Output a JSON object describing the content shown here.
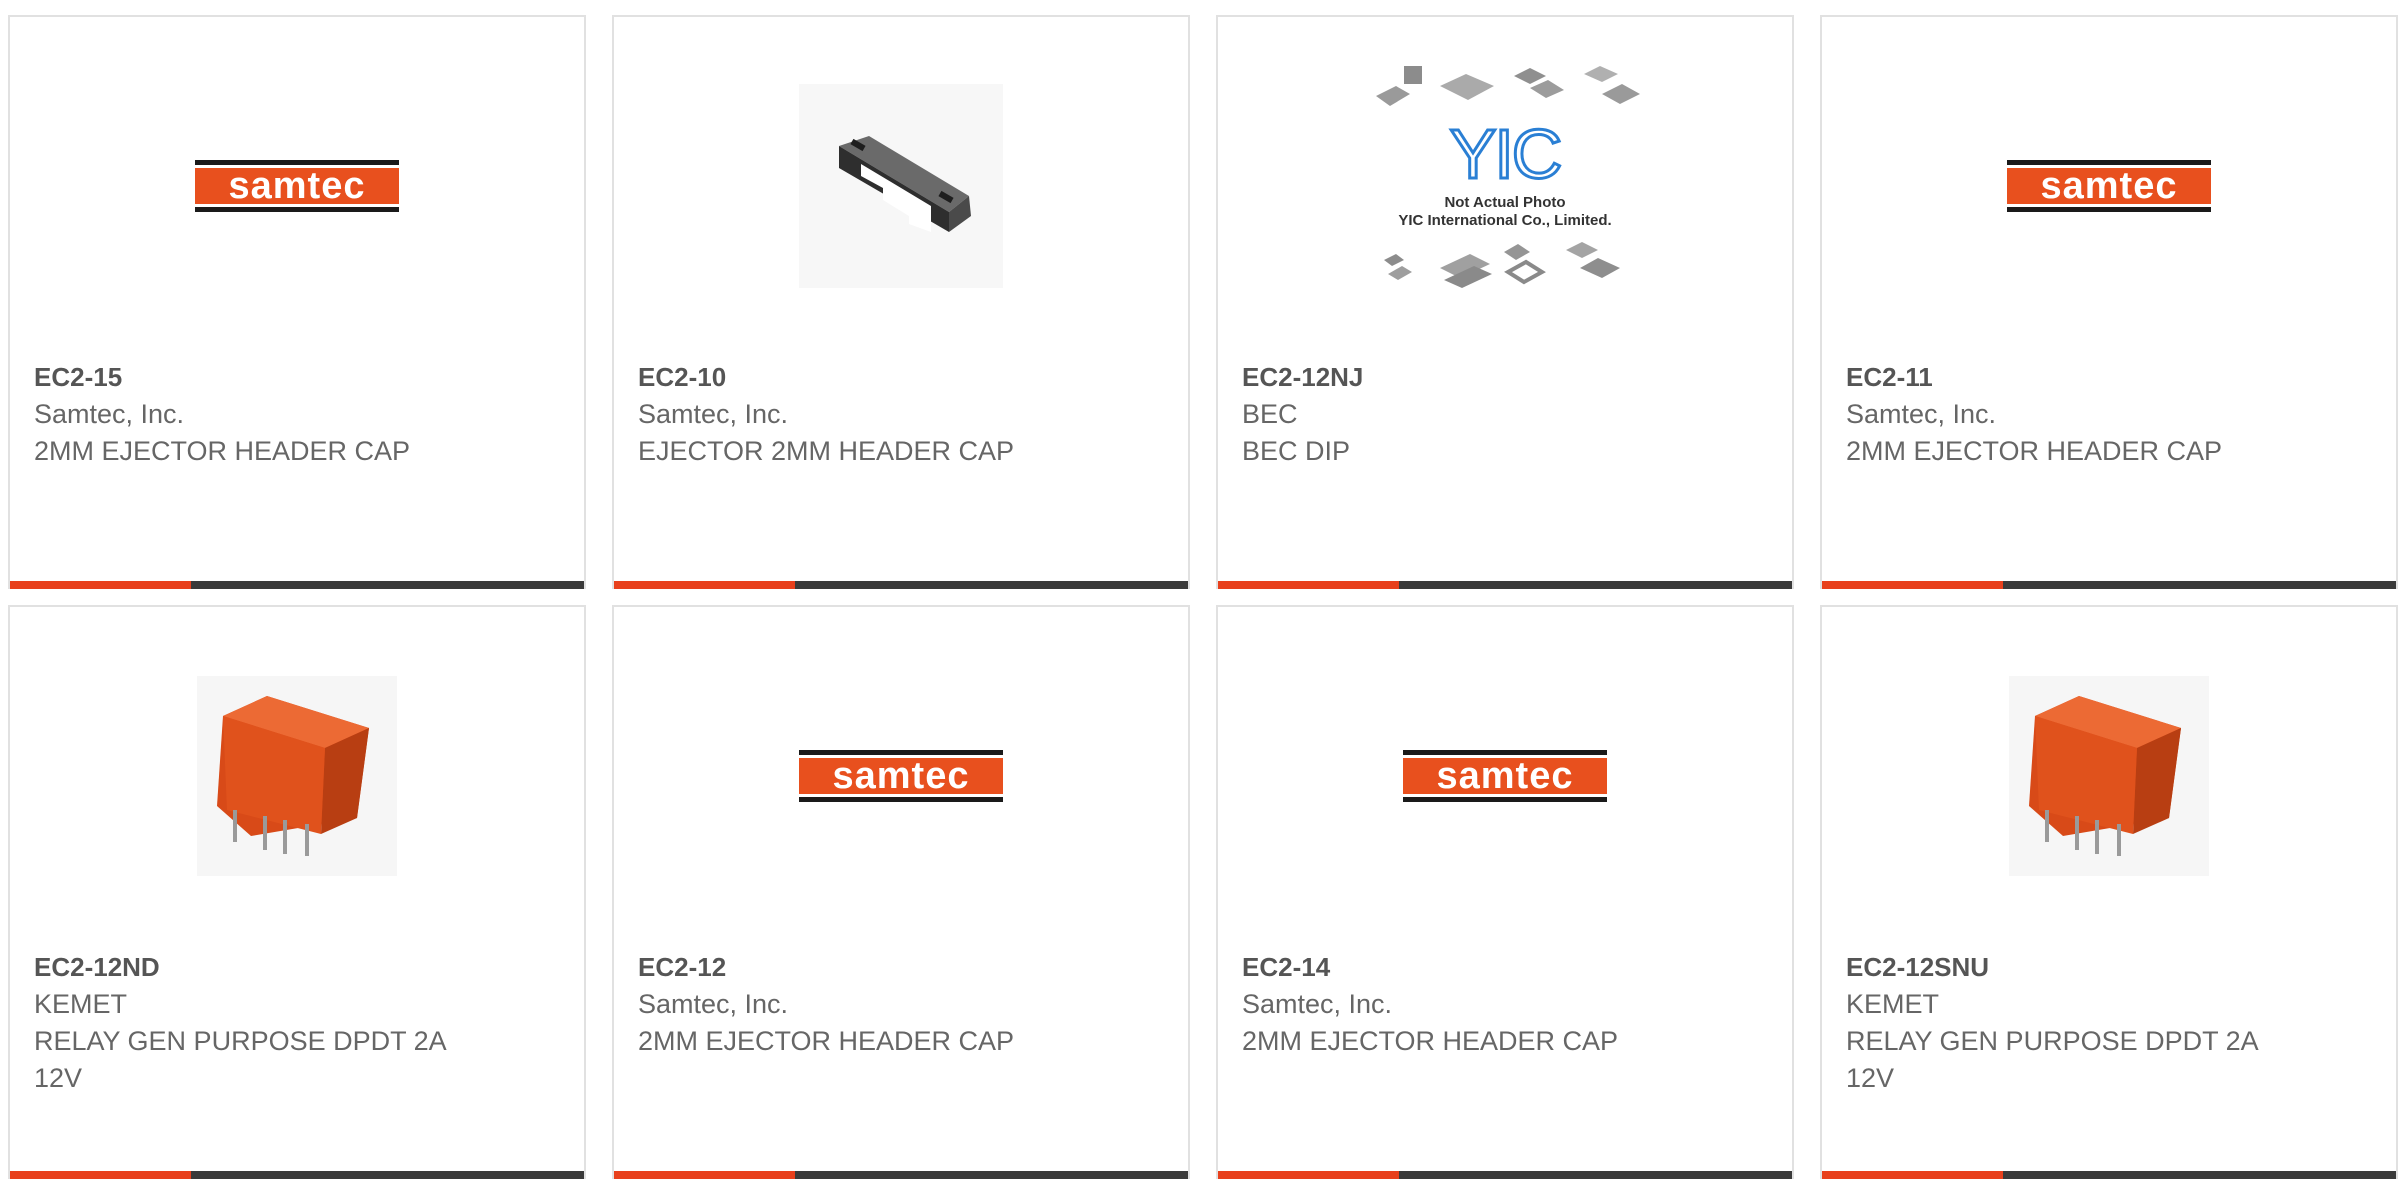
{
  "colors": {
    "accent_orange": "#e8401c",
    "accent_dark": "#3a3a3a",
    "card_border": "#e1e1e1",
    "text_gray": "#666666",
    "samtec_orange": "#e8501e",
    "relay_orange": "#e0521c",
    "yic_blue": "#2a7fd4"
  },
  "products": [
    {
      "part_number": "EC2-15",
      "manufacturer": "Samtec, Inc.",
      "description": "2MM EJECTOR HEADER CAP",
      "image": "samtec-logo",
      "logo_text": "samtec"
    },
    {
      "part_number": "EC2-10",
      "manufacturer": "Samtec, Inc.",
      "description": "EJECTOR 2MM HEADER CAP",
      "image": "ejector-cap-photo"
    },
    {
      "part_number": "EC2-12NJ",
      "manufacturer": "BEC",
      "description": "BEC DIP",
      "image": "yic-placeholder",
      "logo_text": "YIC",
      "caption_line1": "Not Actual Photo",
      "caption_line2": "YIC International Co., Limited."
    },
    {
      "part_number": "EC2-11",
      "manufacturer": "Samtec, Inc.",
      "description": "2MM EJECTOR HEADER CAP",
      "image": "samtec-logo",
      "logo_text": "samtec"
    },
    {
      "part_number": "EC2-12ND",
      "manufacturer": "KEMET",
      "description": "RELAY GEN PURPOSE DPDT 2A 12V",
      "image": "relay-photo"
    },
    {
      "part_number": "EC2-12",
      "manufacturer": "Samtec, Inc.",
      "description": "2MM EJECTOR HEADER CAP",
      "image": "samtec-logo",
      "logo_text": "samtec"
    },
    {
      "part_number": "EC2-14",
      "manufacturer": "Samtec, Inc.",
      "description": "2MM EJECTOR HEADER CAP",
      "image": "samtec-logo",
      "logo_text": "samtec"
    },
    {
      "part_number": "EC2-12SNU",
      "manufacturer": "KEMET",
      "description": "RELAY GEN PURPOSE DPDT 2A 12V",
      "image": "relay-photo"
    }
  ]
}
